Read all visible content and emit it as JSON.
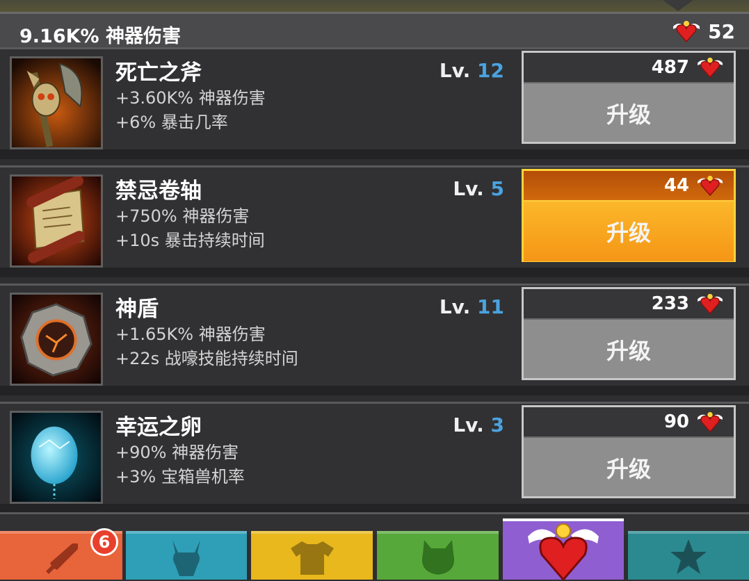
{
  "header": {
    "total_damage": "9.16K% 神器伤害",
    "currency_amount": "52"
  },
  "level_prefix": "Lv.",
  "artifacts": [
    {
      "name": "死亡之斧",
      "stat1": "+3.60K% 神器伤害",
      "stat2": "+6% 暴击几率",
      "level": "12",
      "cost": "487",
      "button_label": "升级",
      "affordable": false,
      "icon": "skull-axe-icon"
    },
    {
      "name": "禁忌卷轴",
      "stat1": "+750% 神器伤害",
      "stat2": "+10s 暴击持续时间",
      "level": "5",
      "cost": "44",
      "button_label": "升级",
      "affordable": true,
      "icon": "scroll-icon"
    },
    {
      "name": "神盾",
      "stat1": "+1.65K% 神器伤害",
      "stat2": "+22s 战嚎技能持续时间",
      "level": "11",
      "cost": "233",
      "button_label": "升级",
      "affordable": false,
      "icon": "aegis-shield-icon"
    },
    {
      "name": "幸运之卵",
      "stat1": "+90% 神器伤害",
      "stat2": "+3% 宝箱兽机率",
      "level": "3",
      "cost": "90",
      "button_label": "升级",
      "affordable": false,
      "icon": "lucky-egg-icon"
    }
  ],
  "tabs": [
    {
      "name": "sword",
      "color": "#e8643a",
      "badge": "6"
    },
    {
      "name": "helmet",
      "color": "#2e9fb7"
    },
    {
      "name": "shirt",
      "color": "#e8b81c"
    },
    {
      "name": "pet",
      "color": "#57a83a"
    },
    {
      "name": "artifacts",
      "color": "#8f5ed0",
      "selected": true
    },
    {
      "name": "star",
      "color": "#2a8a90"
    }
  ],
  "colors": {
    "level_number": "#4aa3e0",
    "active_button": "#f6a21a",
    "inactive_button": "#8e8e8e"
  }
}
